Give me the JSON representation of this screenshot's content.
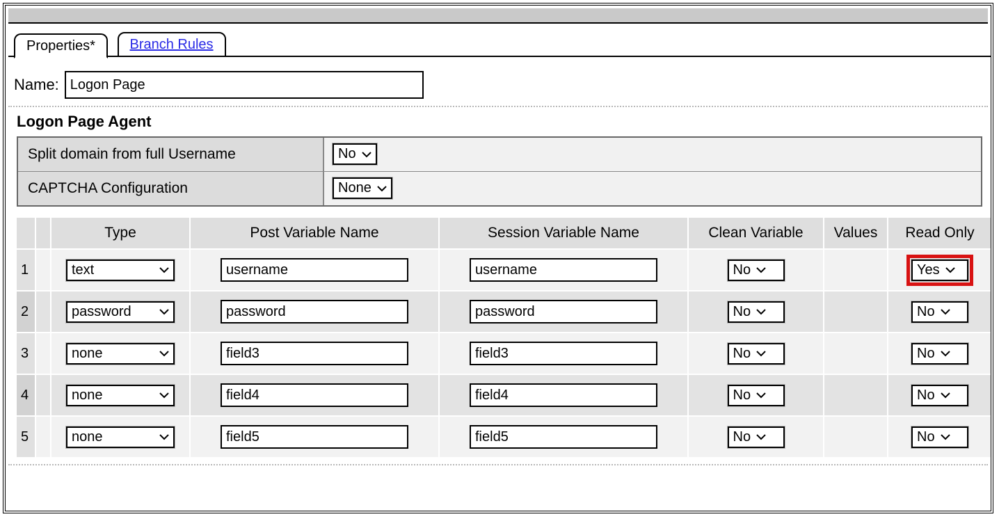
{
  "tabs": {
    "properties": "Properties*",
    "branchRules": "Branch Rules"
  },
  "nameLabel": "Name:",
  "nameValue": "Logon Page",
  "sectionTitle": "Logon Page Agent",
  "settings": {
    "splitDomain": {
      "label": "Split domain from full Username",
      "value": "No"
    },
    "captcha": {
      "label": "CAPTCHA Configuration",
      "value": "None"
    }
  },
  "columns": {
    "type": "Type",
    "postVar": "Post Variable Name",
    "sessionVar": "Session Variable Name",
    "cleanVar": "Clean Variable",
    "values": "Values",
    "readOnly": "Read Only"
  },
  "rows": [
    {
      "n": "1",
      "type": "text",
      "post": "username",
      "session": "username",
      "clean": "No",
      "ro": "Yes"
    },
    {
      "n": "2",
      "type": "password",
      "post": "password",
      "session": "password",
      "clean": "No",
      "ro": "No"
    },
    {
      "n": "3",
      "type": "none",
      "post": "field3",
      "session": "field3",
      "clean": "No",
      "ro": "No"
    },
    {
      "n": "4",
      "type": "none",
      "post": "field4",
      "session": "field4",
      "clean": "No",
      "ro": "No"
    },
    {
      "n": "5",
      "type": "none",
      "post": "field5",
      "session": "field5",
      "clean": "No",
      "ro": "No"
    }
  ]
}
